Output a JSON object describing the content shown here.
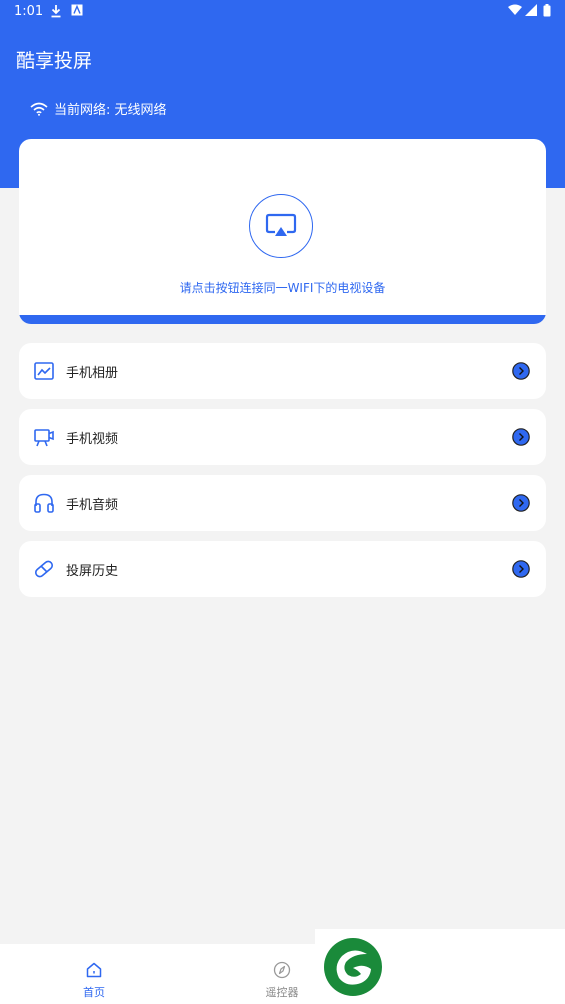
{
  "status_bar": {
    "time": "1:01"
  },
  "header": {
    "title": "酷享投屏",
    "network_label": "当前网络: 无线网络"
  },
  "cast_card": {
    "hint": "请点击按钮连接同一WIFI下的电视设备"
  },
  "menu": [
    {
      "label": "手机相册",
      "icon": "photo-album-icon"
    },
    {
      "label": "手机视频",
      "icon": "video-camera-icon"
    },
    {
      "label": "手机音频",
      "icon": "headphones-icon"
    },
    {
      "label": "投屏历史",
      "icon": "pill-history-icon"
    }
  ],
  "nav": {
    "home_label": "首页",
    "remote_label": "遥控器"
  },
  "colors": {
    "accent": "#2f68f0",
    "background": "#f3f3f3",
    "logo_green": "#1a8a3a"
  }
}
